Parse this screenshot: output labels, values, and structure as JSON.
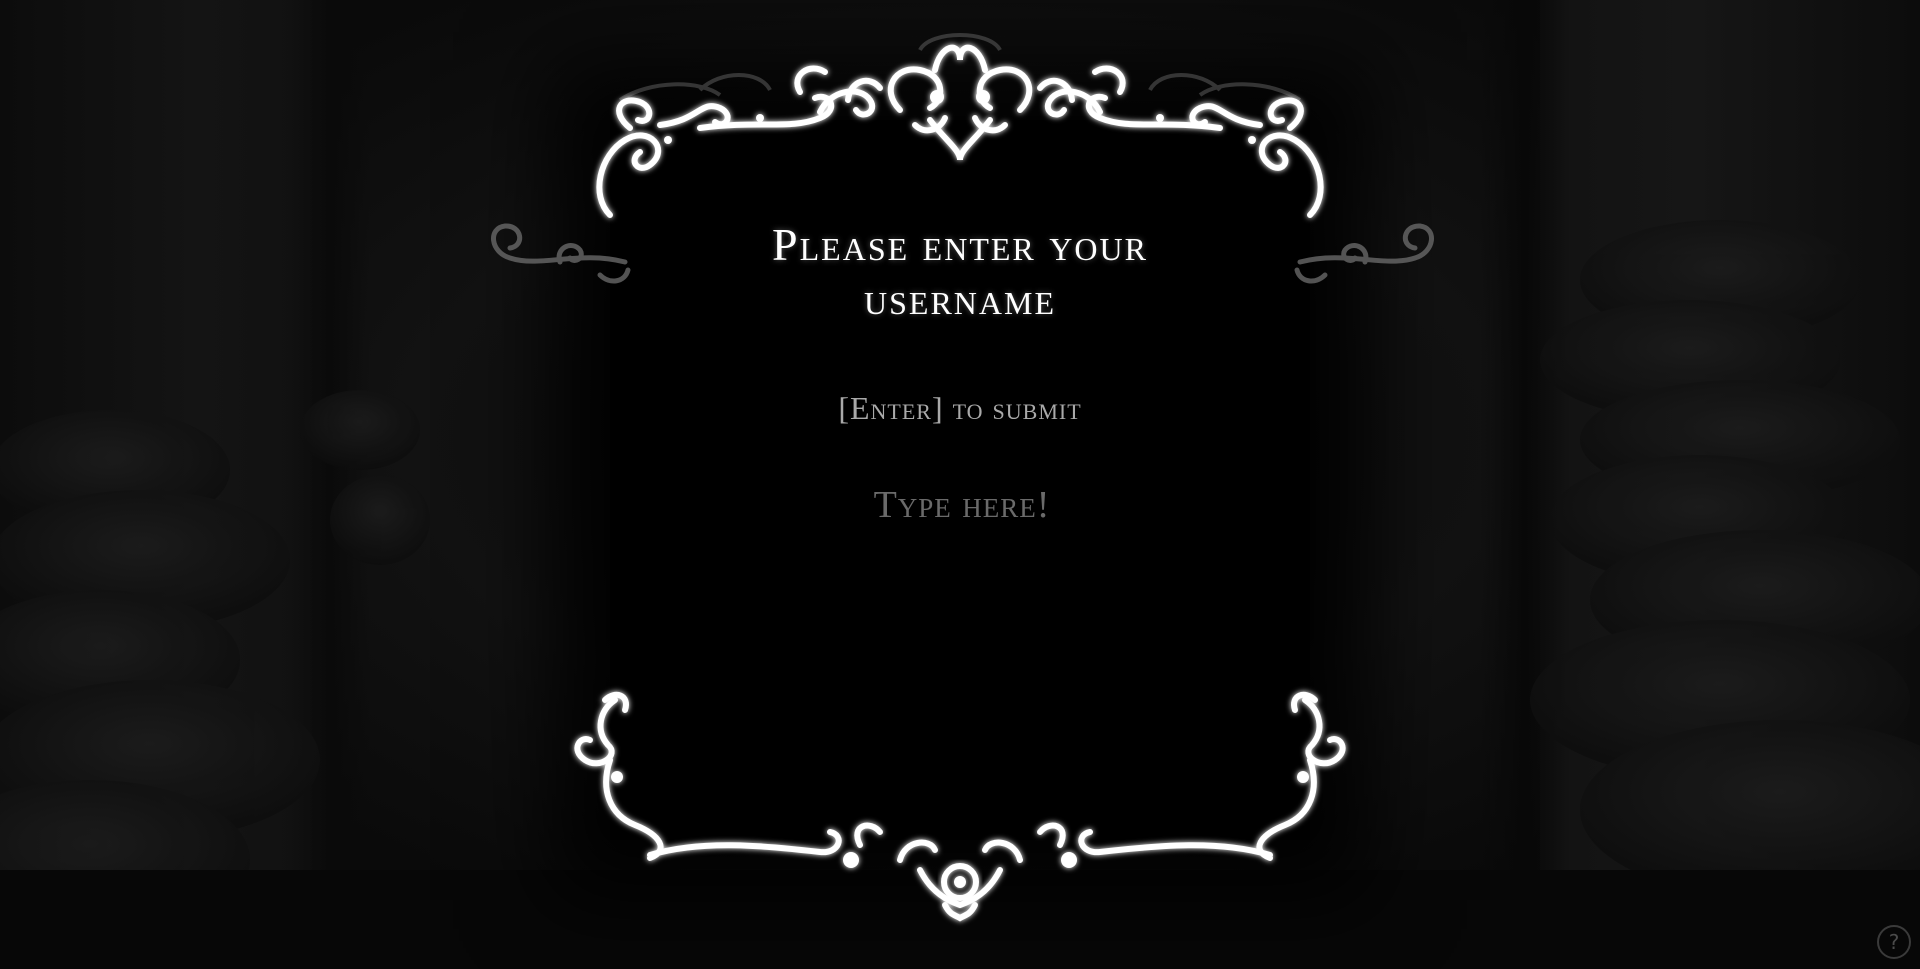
{
  "prompt": {
    "title_line1": "Please enter your",
    "title_line2": "username",
    "hint": "[Enter] to submit",
    "input_placeholder": "Type here!",
    "input_value": ""
  },
  "help": {
    "label": "?"
  },
  "colors": {
    "background": "#000000",
    "frame_ornament": "#ffffff",
    "title_text": "#ffffff",
    "hint_text": "#a9a9a9",
    "placeholder_text": "#6a6a6a"
  },
  "icons": {
    "frame_top": "ornate-filigree-top",
    "frame_bottom": "ornate-filigree-bottom",
    "help": "question-mark-circle-icon"
  }
}
